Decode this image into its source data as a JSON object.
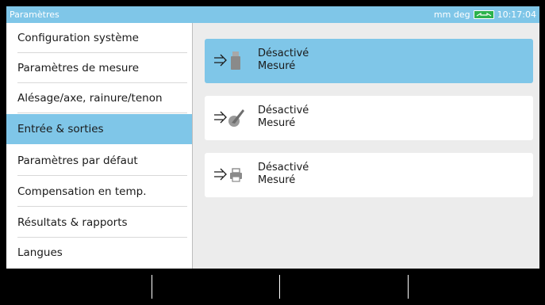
{
  "titlebar": {
    "title": "Paramètres",
    "units": "mm deg",
    "time": "10:17:04"
  },
  "sidebar": {
    "items": [
      {
        "label": "Configuration système"
      },
      {
        "label": "Paramètres de mesure"
      },
      {
        "label": "Alésage/axe, rainure/tenon"
      },
      {
        "label": "Entrée & sorties",
        "active": true
      },
      {
        "label": "Paramètres par défaut"
      },
      {
        "label": "Compensation en temp."
      },
      {
        "label": "Résultats & rapports"
      },
      {
        "label": "Langues"
      }
    ]
  },
  "main": {
    "cards": [
      {
        "device_icon": "usb-drive-icon",
        "status": "Désactivé",
        "subtitle": "Mesuré",
        "active": true
      },
      {
        "device_icon": "quill-pen-icon",
        "status": "Désactivé",
        "subtitle": "Mesuré"
      },
      {
        "device_icon": "printer-icon",
        "status": "Désactivé",
        "subtitle": "Mesuré"
      }
    ]
  },
  "colors": {
    "accent": "#7fc6e8",
    "battery": "#2bb24c"
  }
}
